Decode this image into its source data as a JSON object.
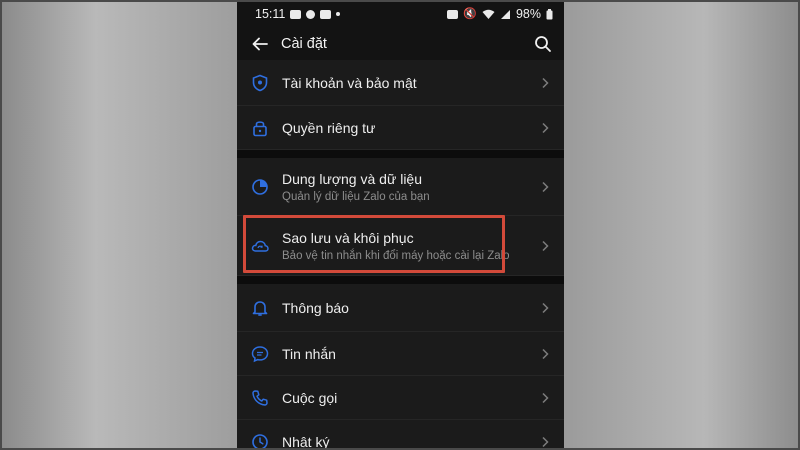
{
  "status_bar": {
    "time": "15:11",
    "battery": "98%"
  },
  "app_bar": {
    "title": "Cài đặt"
  },
  "settings": {
    "group1": [
      {
        "label": "Tài khoản và bảo mật",
        "icon": "shield-icon"
      },
      {
        "label": "Quyền riêng tư",
        "icon": "lock-icon"
      }
    ],
    "group2": [
      {
        "label": "Dung lượng và dữ liệu",
        "sub": "Quản lý dữ liệu Zalo của bạn",
        "icon": "pie-chart-icon"
      },
      {
        "label": "Sao lưu và khôi phục",
        "sub": "Bảo vệ tin nhắn khi đổi máy hoặc cài lại Zalo",
        "icon": "cloud-sync-icon"
      }
    ],
    "group3": [
      {
        "label": "Thông báo",
        "icon": "bell-icon"
      },
      {
        "label": "Tin nhắn",
        "icon": "chat-bubble-icon"
      },
      {
        "label": "Cuộc gọi",
        "icon": "phone-icon"
      },
      {
        "label": "Nhật ký",
        "icon": "clock-icon"
      }
    ]
  },
  "colors": {
    "accent": "#2f6fe0",
    "highlight": "#d24a3a",
    "background": "#1b1b1b"
  }
}
